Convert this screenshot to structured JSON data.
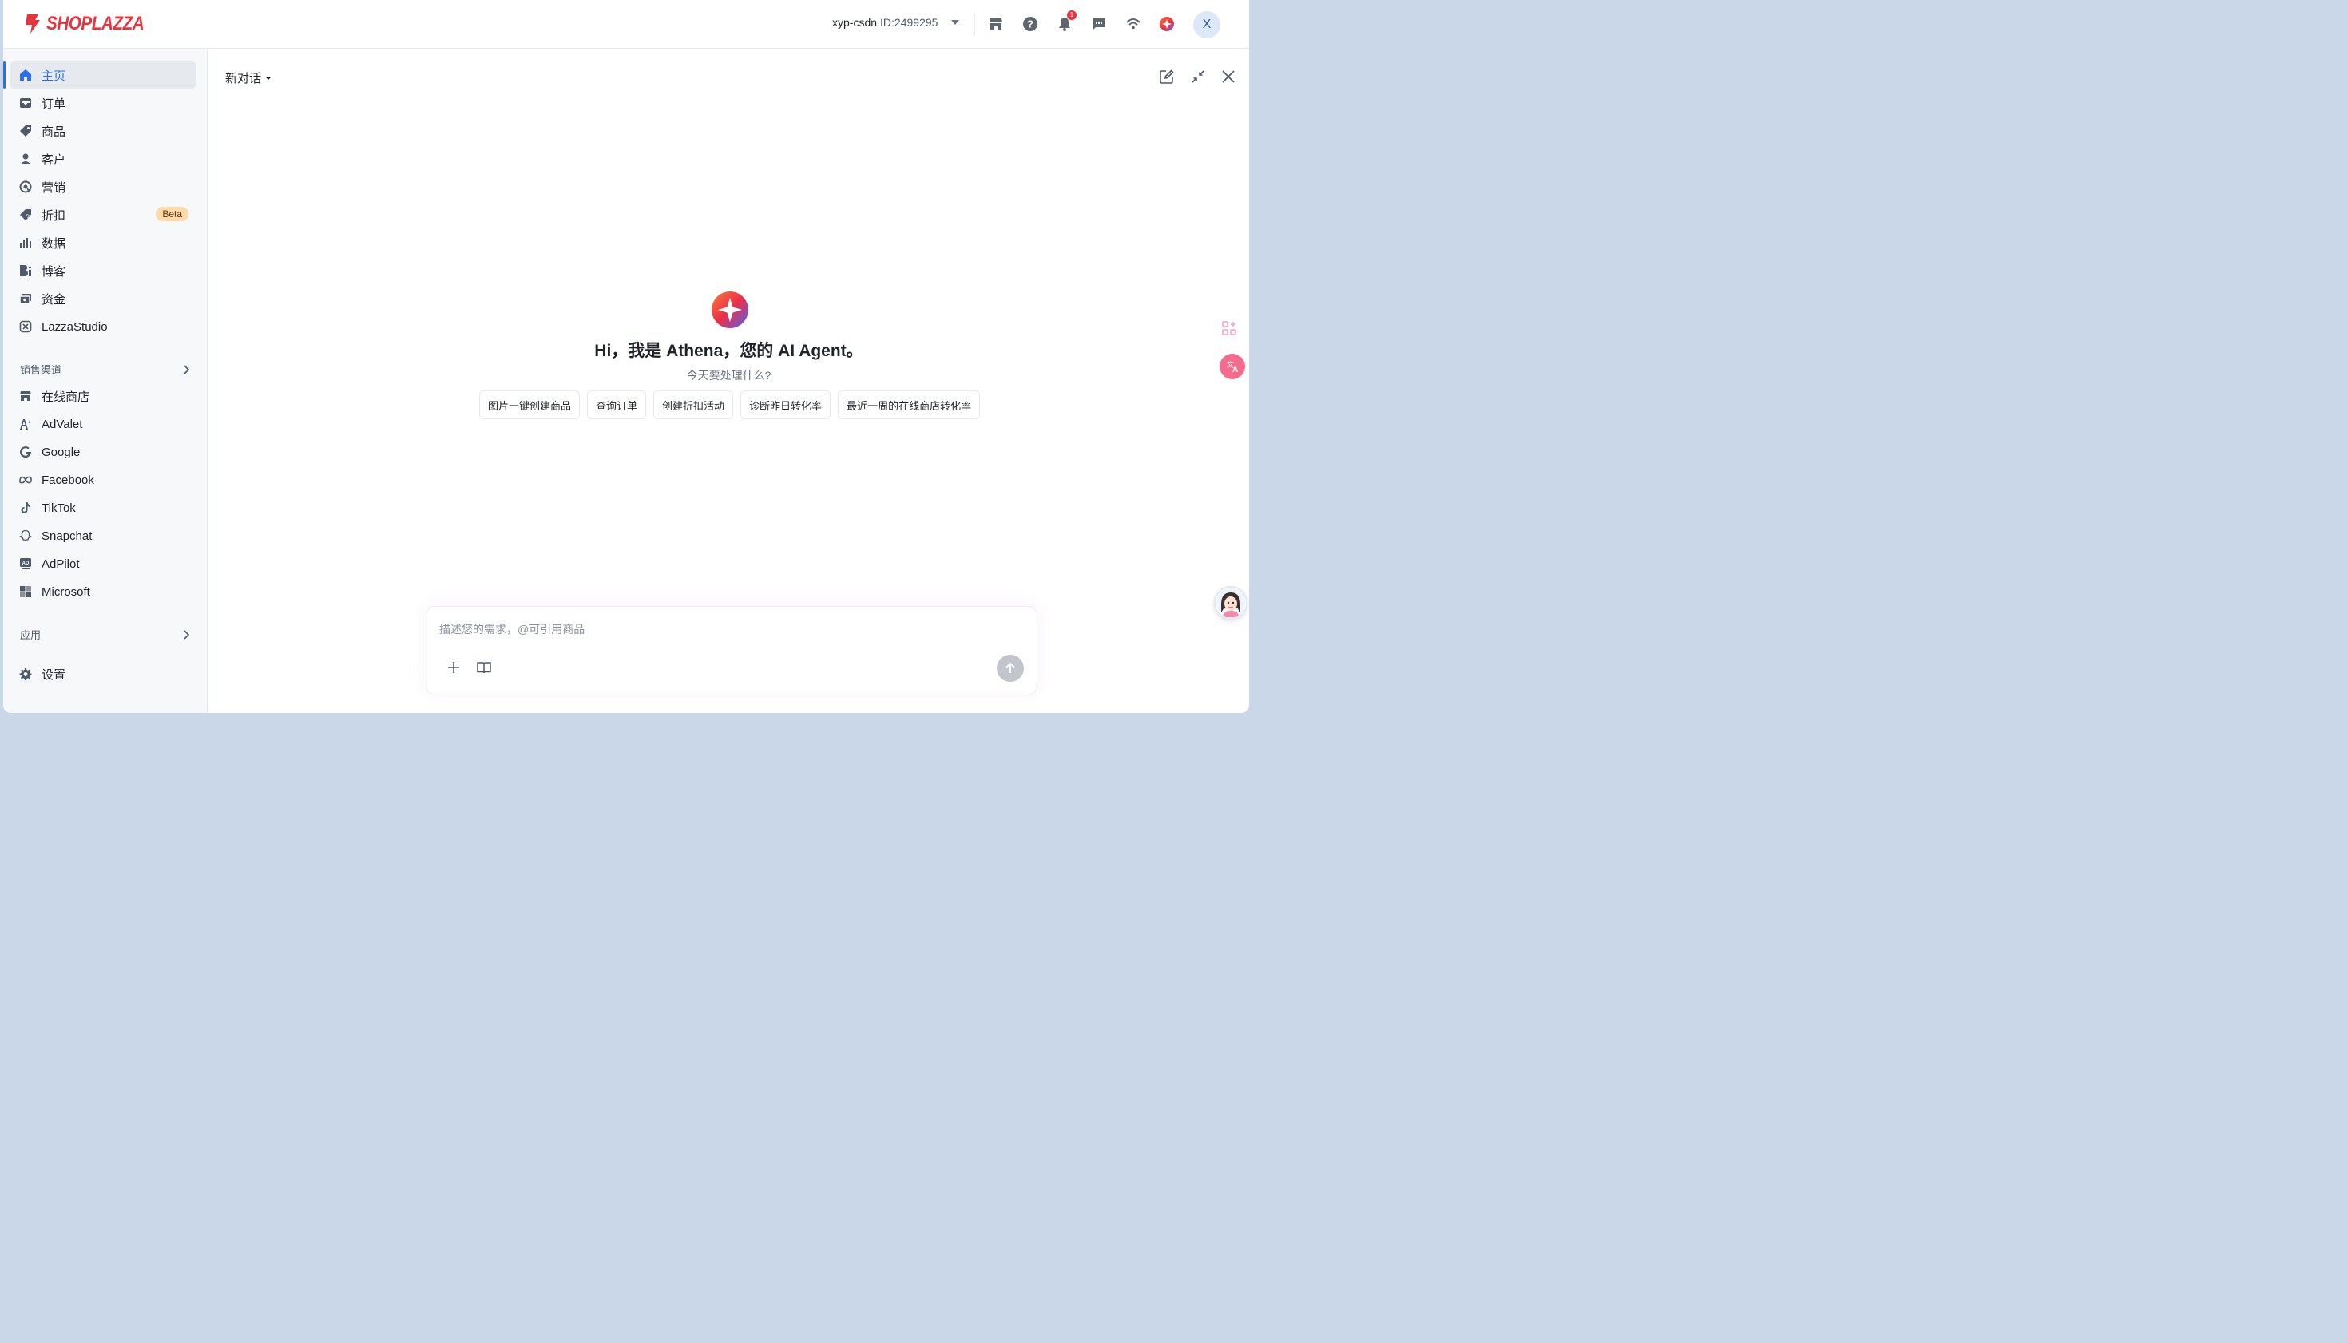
{
  "brand": {
    "name": "SHOPLAZZA",
    "color": "#e8333e"
  },
  "header": {
    "account_name": "xyp-csdn",
    "account_id": "ID:2499295",
    "notification_count": "1",
    "avatar_initial": "X",
    "icons": [
      "store-icon",
      "help-icon",
      "bell-icon",
      "chat-icon",
      "wifi-icon",
      "athena-icon"
    ]
  },
  "sidebar": {
    "items": [
      {
        "label": "主页",
        "icon": "home-icon",
        "active": true
      },
      {
        "label": "订单",
        "icon": "inbox-icon"
      },
      {
        "label": "商品",
        "icon": "tag-icon"
      },
      {
        "label": "客户",
        "icon": "person-icon"
      },
      {
        "label": "营销",
        "icon": "target-icon"
      },
      {
        "label": "折扣",
        "icon": "discount-tag-icon",
        "badge": "Beta"
      },
      {
        "label": "数据",
        "icon": "bar-chart-icon"
      },
      {
        "label": "博客",
        "icon": "blog-icon"
      },
      {
        "label": "资金",
        "icon": "wallet-icon"
      },
      {
        "label": "LazzaStudio",
        "icon": "studio-icon"
      }
    ],
    "sales_channels": {
      "title": "销售渠道",
      "items": [
        {
          "label": "在线商店",
          "icon": "store-icon"
        },
        {
          "label": "AdValet",
          "icon": "advalet-icon"
        },
        {
          "label": "Google",
          "icon": "google-icon"
        },
        {
          "label": "Facebook",
          "icon": "meta-icon"
        },
        {
          "label": "TikTok",
          "icon": "tiktok-icon"
        },
        {
          "label": "Snapchat",
          "icon": "snapchat-icon"
        },
        {
          "label": "AdPilot",
          "icon": "adpilot-icon"
        },
        {
          "label": "Microsoft",
          "icon": "microsoft-icon"
        }
      ]
    },
    "apps": {
      "title": "应用"
    },
    "settings": {
      "label": "设置",
      "icon": "gear-icon"
    }
  },
  "main": {
    "conversation_title": "新对话",
    "greeting": "Hi，我是 Athena，您的 AI Agent。",
    "subtitle": "今天要处理什么?",
    "suggestions": [
      "图片一键创建商品",
      "查询订单",
      "创建折扣活动",
      "诊断昨日转化率",
      "最近一周的在线商店转化率"
    ],
    "input_placeholder": "描述您的需求，@可引用商品",
    "input_value": ""
  },
  "colors": {
    "accent": "#2b6fe8",
    "beta_badge": "#ffd9a8",
    "send_disabled": "#c2c5cb"
  }
}
